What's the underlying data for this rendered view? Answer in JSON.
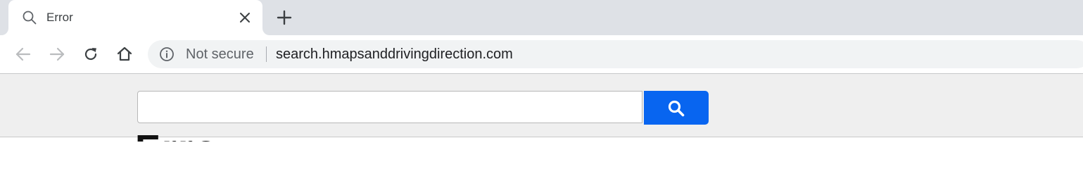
{
  "browser": {
    "tab": {
      "title": "Error",
      "icon": "search-icon",
      "close_icon": "close-icon"
    },
    "new_tab_icon": "plus-icon",
    "nav": {
      "back_icon": "arrow-left-icon",
      "forward_icon": "arrow-right-icon",
      "reload_icon": "reload-icon",
      "home_icon": "home-icon"
    },
    "omnibox": {
      "security_icon": "info-icon",
      "security_label": "Not secure",
      "url": "search.hmapsanddrivingdirection.com"
    }
  },
  "page": {
    "search": {
      "value": "",
      "placeholder": "",
      "button_icon": "search-icon",
      "button_color": "#0865f0"
    },
    "heading_partial": "Erro"
  },
  "colors": {
    "tabstrip": "#dee1e6",
    "omnibox": "#f1f3f4",
    "search_band": "#efefef",
    "accent": "#0865f0"
  }
}
